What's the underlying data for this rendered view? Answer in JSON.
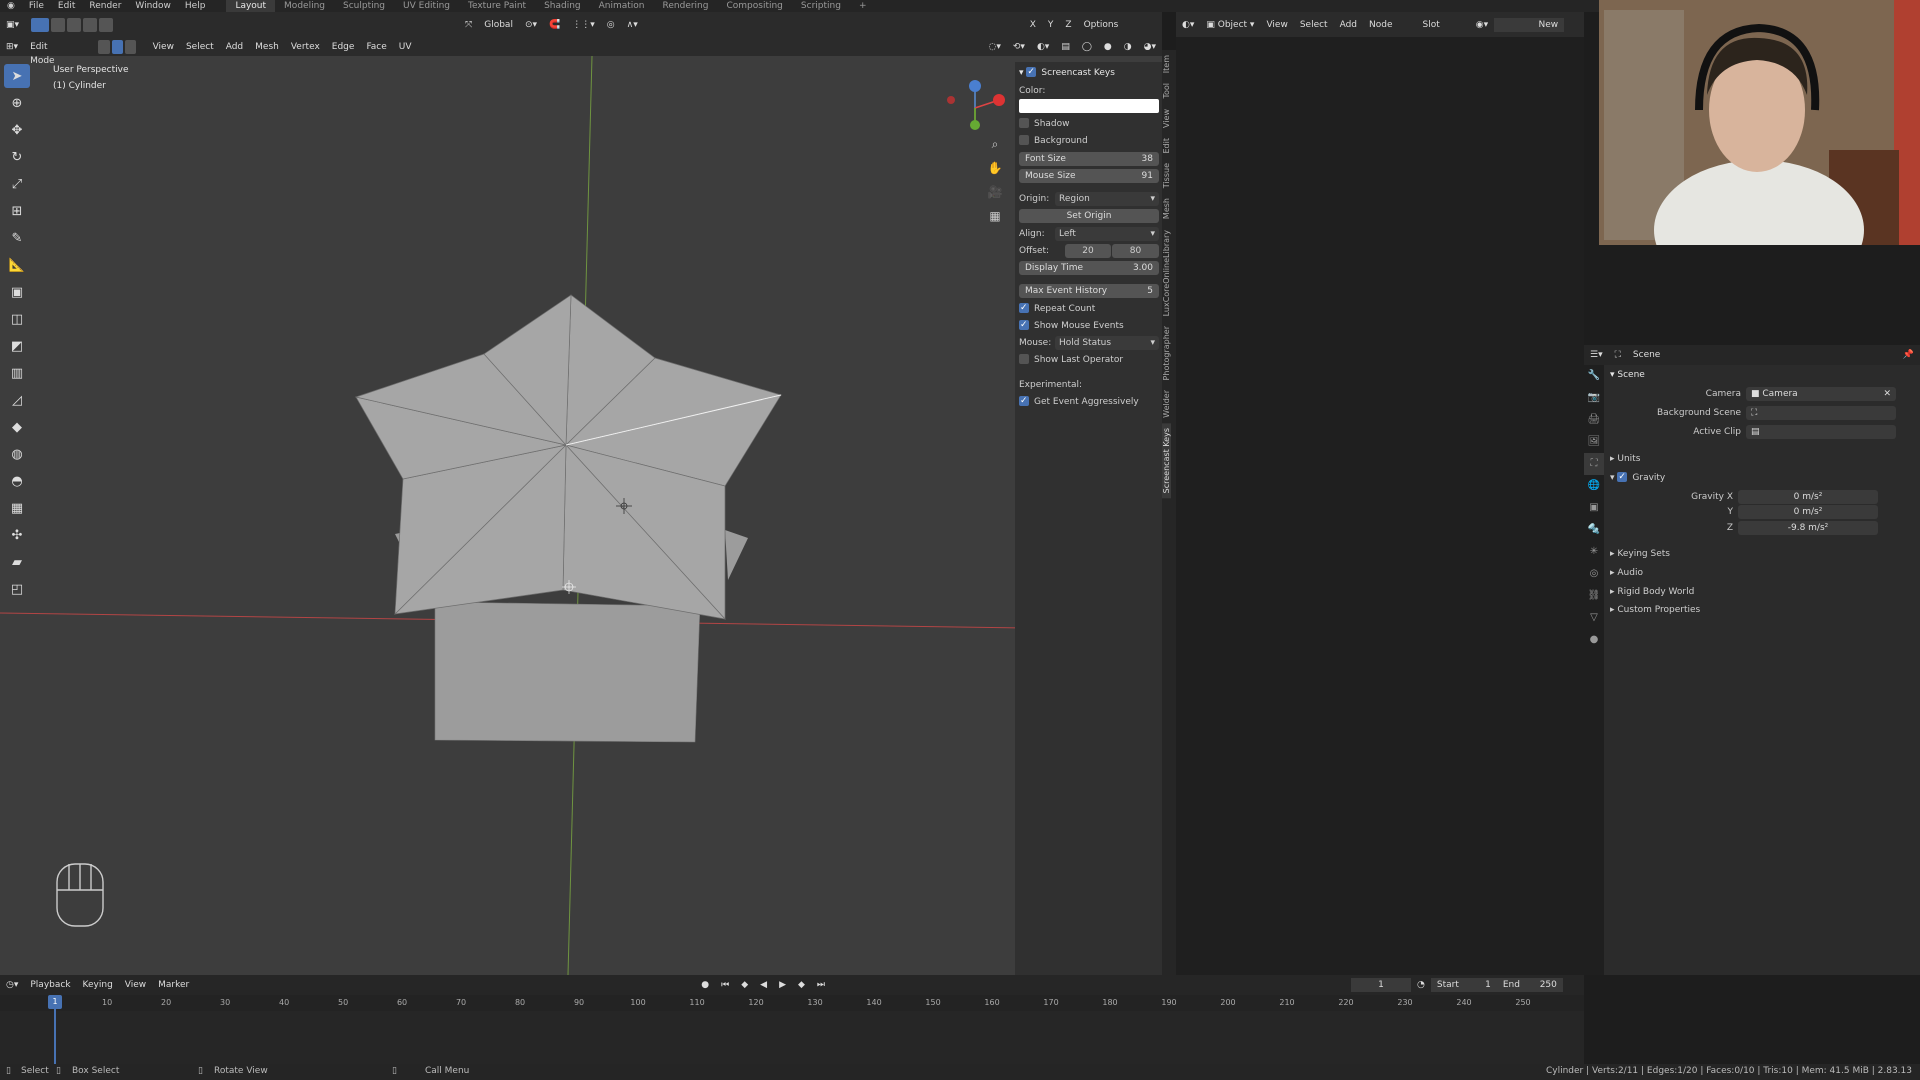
{
  "topbar": {
    "menus": [
      "File",
      "Edit",
      "Render",
      "Window",
      "Help"
    ],
    "workspaces": [
      "Layout",
      "Modeling",
      "Sculpting",
      "UV Editing",
      "Texture Paint",
      "Shading",
      "Animation",
      "Rendering",
      "Compositing",
      "Scripting"
    ],
    "add_tab": "+"
  },
  "viewport": {
    "mode": "Edit Mode",
    "menus": [
      "View",
      "Select",
      "Add",
      "Mesh",
      "Vertex",
      "Edge",
      "Face",
      "UV"
    ],
    "orientation": "Global",
    "options": "Options",
    "overlay_line1": "User Perspective",
    "overlay_line2": "(1) Cylinder",
    "axes": [
      "X",
      "Y",
      "Z"
    ]
  },
  "npanel": {
    "title": "Screencast Keys",
    "color_label": "Color:",
    "shadow": "Shadow",
    "background": "Background",
    "font_size_label": "Font Size",
    "font_size_value": "38",
    "mouse_size_label": "Mouse Size",
    "mouse_size_value": "91",
    "origin_label": "Origin:",
    "origin_value": "Region",
    "set_origin": "Set Origin",
    "align_label": "Align:",
    "align_value": "Left",
    "offset_label": "Offset:",
    "offset_x": "20",
    "offset_y": "80",
    "display_time_label": "Display Time",
    "display_time_value": "3.00",
    "max_event_label": "Max Event History",
    "max_event_value": "5",
    "repeat_count": "Repeat Count",
    "show_mouse_events": "Show Mouse Events",
    "mouse_label": "Mouse:",
    "mouse_value": "Hold Status",
    "show_last_operator": "Show Last Operator",
    "experimental": "Experimental:",
    "get_event": "Get Event Aggressively",
    "tabs": [
      "Item",
      "Tool",
      "View",
      "Edit",
      "Tissue",
      "Mesh",
      "LuxCoreOnlineLibrary",
      "Photographer",
      "Welder",
      "Screencast Keys"
    ]
  },
  "node_editor": {
    "mode": "Object",
    "menus": [
      "View",
      "Select",
      "Add",
      "Node"
    ],
    "slot": "Slot",
    "new": "New"
  },
  "properties": {
    "header": "Scene",
    "panel_scene": "Scene",
    "camera_label": "Camera",
    "camera_value": "Camera",
    "bg_scene_label": "Background Scene",
    "active_clip_label": "Active Clip",
    "units": "Units",
    "gravity": "Gravity",
    "gravity_x_label": "Gravity X",
    "gravity_x": "0 m/s²",
    "gravity_y_label": "Y",
    "gravity_y": "0 m/s²",
    "gravity_z_label": "Z",
    "gravity_z": "-9.8 m/s²",
    "keying_sets": "Keying Sets",
    "audio": "Audio",
    "rigid_body_world": "Rigid Body World",
    "custom_properties": "Custom Properties"
  },
  "timeline": {
    "menus": [
      "Playback",
      "Keying",
      "View",
      "Marker"
    ],
    "current_frame": "1",
    "start_label": "Start",
    "start": "1",
    "end_label": "End",
    "end": "250",
    "ticks": [
      "10",
      "20",
      "30",
      "40",
      "50",
      "60",
      "70",
      "80",
      "90",
      "100",
      "110",
      "120",
      "130",
      "140",
      "150",
      "160",
      "170",
      "180",
      "190",
      "200",
      "210",
      "220",
      "230",
      "240",
      "250"
    ]
  },
  "statusbar": {
    "select": "Select",
    "box_select": "Box Select",
    "rotate_view": "Rotate View",
    "call_menu": "Call Menu",
    "stats": "Cylinder | Verts:2/11 | Edges:1/20 | Faces:0/10 | Tris:10 | Mem: 41.5 MiB | 2.83.13"
  },
  "colors": {
    "accent": "#4772b3",
    "viewport_bg": "#3d3d3d",
    "mesh_face": "#a6a6a6",
    "x_axis": "#c84c4c",
    "y_axis": "#7fa84a"
  }
}
